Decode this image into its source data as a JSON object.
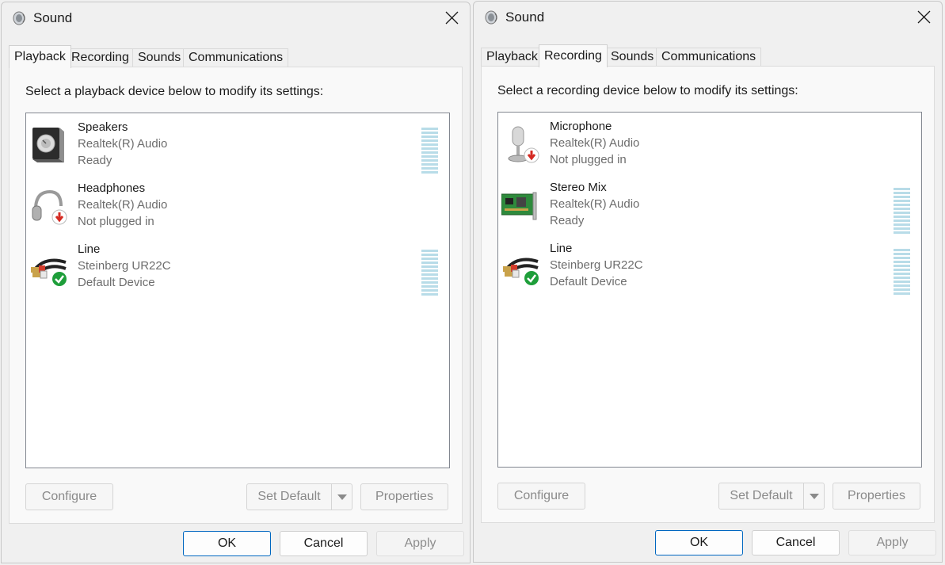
{
  "windows": [
    {
      "title": "Sound",
      "tabs": [
        "Playback",
        "Recording",
        "Sounds",
        "Communications"
      ],
      "active_tab": "Playback",
      "instruction": "Select a playback device below to modify its settings:",
      "devices": [
        {
          "name": "Speakers",
          "driver": "Realtek(R) Audio",
          "status": "Ready",
          "icon": "speaker-icon",
          "level_meter": true
        },
        {
          "name": "Headphones",
          "driver": "Realtek(R) Audio",
          "status": "Not plugged in",
          "icon": "headphones-unplugged-icon",
          "level_meter": false
        },
        {
          "name": "Line",
          "driver": "Steinberg UR22C",
          "status": "Default Device",
          "icon": "line-cable-default-icon",
          "level_meter": true
        }
      ],
      "buttons": {
        "configure": "Configure",
        "set_default": "Set Default",
        "properties": "Properties",
        "ok": "OK",
        "cancel": "Cancel",
        "apply": "Apply"
      }
    },
    {
      "title": "Sound",
      "tabs": [
        "Playback",
        "Recording",
        "Sounds",
        "Communications"
      ],
      "active_tab": "Recording",
      "instruction": "Select a recording device below to modify its settings:",
      "devices": [
        {
          "name": "Microphone",
          "driver": "Realtek(R) Audio",
          "status": "Not plugged in",
          "icon": "microphone-unplugged-icon",
          "level_meter": false
        },
        {
          "name": "Stereo Mix",
          "driver": "Realtek(R) Audio",
          "status": "Ready",
          "icon": "sound-card-icon",
          "level_meter": true
        },
        {
          "name": "Line",
          "driver": "Steinberg UR22C",
          "status": "Default Device",
          "icon": "line-cable-default-icon",
          "level_meter": true
        }
      ],
      "buttons": {
        "configure": "Configure",
        "set_default": "Set Default",
        "properties": "Properties",
        "ok": "OK",
        "cancel": "Cancel",
        "apply": "Apply"
      }
    }
  ],
  "colors": {
    "accent": "#0067c0",
    "meter": "#b8dce8",
    "default_check": "#1e9e3a",
    "unplugged": "#d42a22"
  }
}
